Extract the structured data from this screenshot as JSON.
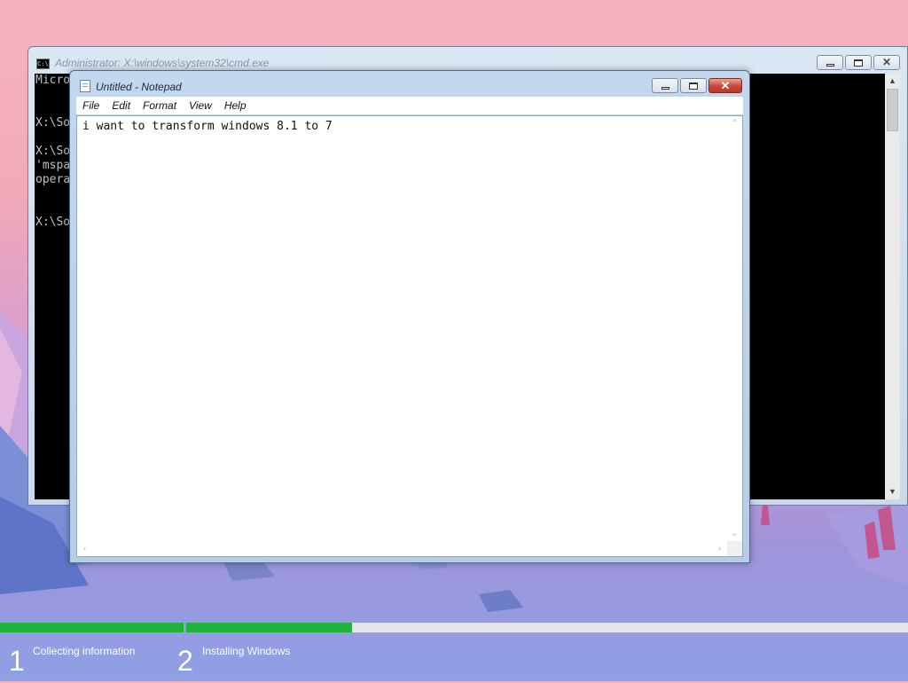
{
  "desktop": {
    "background_colors": [
      "#f6b3bf",
      "#d49ad0",
      "#8ea0e6"
    ]
  },
  "cmd": {
    "title": "Administrator: X:\\windows\\system32\\cmd.exe",
    "icon": "console-icon",
    "lines": [
      "Micro",
      "",
      "",
      "X:\\So",
      "",
      "X:\\So",
      "'mspa",
      "opera",
      "",
      "",
      "X:\\So"
    ]
  },
  "notepad": {
    "title": "Untitled - Notepad",
    "icon": "notepad-icon",
    "menu": [
      "File",
      "Edit",
      "Format",
      "View",
      "Help"
    ],
    "content": "i want to transform windows 8.1 to 7"
  },
  "setup": {
    "accent": "#1fb33c",
    "steps": [
      {
        "number": "1",
        "label": "Collecting information",
        "progress": 1.0
      },
      {
        "number": "2",
        "label": "Installing Windows",
        "progress": 0.23
      }
    ]
  }
}
